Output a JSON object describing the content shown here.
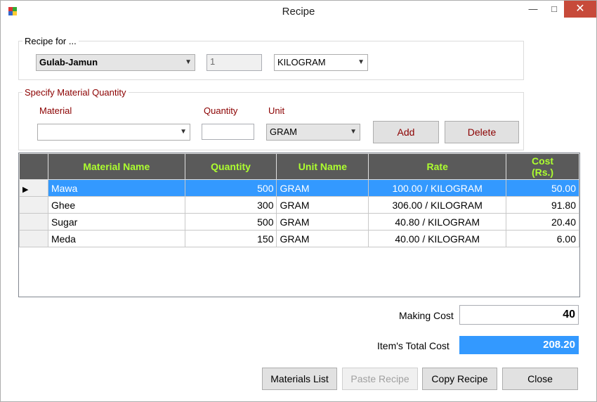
{
  "window": {
    "title": "Recipe"
  },
  "recipe_group": {
    "label": "Recipe for ...",
    "recipe_value": "Gulab-Jamun",
    "quantity_value": "1",
    "unit_value": "KILOGRAM"
  },
  "material_group": {
    "label": "Specify Material Quantity",
    "material_label": "Material",
    "quantity_label": "Quantity",
    "unit_label": "Unit",
    "material_value": "",
    "quantity_value": "",
    "unit_value": "GRAM",
    "add_label": "Add",
    "delete_label": "Delete"
  },
  "grid": {
    "headers": [
      "Material Name",
      "Quantity",
      "Unit Name",
      "Rate",
      "Cost (Rs.)"
    ],
    "rows": [
      {
        "name": "Mawa",
        "quantity": "500",
        "unit": "GRAM",
        "rate": "100.00 / KILOGRAM",
        "cost": "50.00"
      },
      {
        "name": "Ghee",
        "quantity": "300",
        "unit": "GRAM",
        "rate": "306.00 / KILOGRAM",
        "cost": "91.80"
      },
      {
        "name": "Sugar",
        "quantity": "500",
        "unit": "GRAM",
        "rate": "40.80 / KILOGRAM",
        "cost": "20.40"
      },
      {
        "name": "Meda",
        "quantity": "150",
        "unit": "GRAM",
        "rate": "40.00 / KILOGRAM",
        "cost": "6.00"
      }
    ]
  },
  "totals": {
    "making_cost_label": "Making Cost",
    "making_cost_value": "40",
    "total_cost_label": "Item's Total Cost",
    "total_cost_value": "208.20"
  },
  "buttons": {
    "materials_list": "Materials List",
    "paste_recipe": "Paste Recipe",
    "copy_recipe": "Copy Recipe",
    "close": "Close"
  },
  "colors": {
    "accent": "#3399ff",
    "label_red": "#8b0000",
    "header_text": "#adff2f",
    "header_bg": "#5a5a5a"
  }
}
